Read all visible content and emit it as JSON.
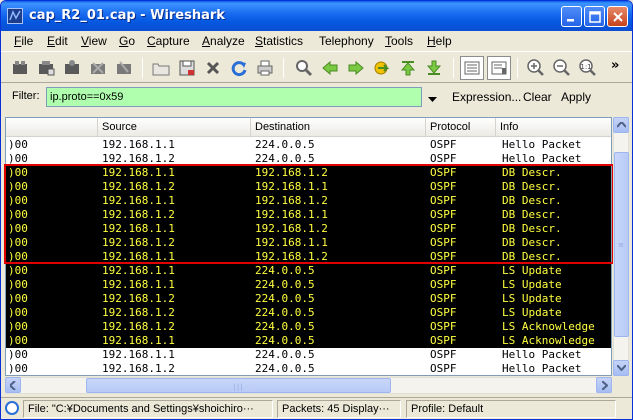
{
  "window": {
    "title": "cap_R2_01.cap - Wireshark"
  },
  "menu": [
    {
      "label": "File",
      "u": "F",
      "rest": "ile"
    },
    {
      "label": "Edit",
      "u": "E",
      "rest": "dit"
    },
    {
      "label": "View",
      "u": "V",
      "rest": "iew"
    },
    {
      "label": "Go",
      "u": "G",
      "rest": "o"
    },
    {
      "label": "Capture",
      "u": "C",
      "rest": "apture"
    },
    {
      "label": "Analyze",
      "u": "A",
      "rest": "nalyze"
    },
    {
      "label": "Statistics",
      "u": "S",
      "rest": "tatistics"
    },
    {
      "label": "Telephony",
      "u": "",
      "rest": "Telephony"
    },
    {
      "label": "Tools",
      "u": "T",
      "rest": "ools"
    },
    {
      "label": "Help",
      "u": "H",
      "rest": "elp"
    }
  ],
  "filter": {
    "label": "Filter:",
    "value": "ip.proto==0x59",
    "expression": "Expression...",
    "clear": "Clear",
    "apply": "Apply"
  },
  "columns": [
    "Source",
    "Destination",
    "Protocol",
    "Info"
  ],
  "packets": [
    {
      "no": ")00",
      "src": "192.168.1.1",
      "dst": "224.0.0.5",
      "proto": "OSPF",
      "info": "Hello Packet",
      "style": "hello"
    },
    {
      "no": ")00",
      "src": "192.168.1.2",
      "dst": "224.0.0.5",
      "proto": "OSPF",
      "info": "Hello Packet",
      "style": "hello"
    },
    {
      "no": ")00",
      "src": "192.168.1.1",
      "dst": "192.168.1.2",
      "proto": "OSPF",
      "info": "DB Descr.",
      "style": "db"
    },
    {
      "no": ")00",
      "src": "192.168.1.2",
      "dst": "192.168.1.1",
      "proto": "OSPF",
      "info": "DB Descr.",
      "style": "db"
    },
    {
      "no": ")00",
      "src": "192.168.1.1",
      "dst": "192.168.1.2",
      "proto": "OSPF",
      "info": "DB Descr.",
      "style": "db"
    },
    {
      "no": ")00",
      "src": "192.168.1.2",
      "dst": "192.168.1.1",
      "proto": "OSPF",
      "info": "DB Descr.",
      "style": "db"
    },
    {
      "no": ")00",
      "src": "192.168.1.1",
      "dst": "192.168.1.2",
      "proto": "OSPF",
      "info": "DB Descr.",
      "style": "db"
    },
    {
      "no": ")00",
      "src": "192.168.1.2",
      "dst": "192.168.1.1",
      "proto": "OSPF",
      "info": "DB Descr.",
      "style": "db"
    },
    {
      "no": ")00",
      "src": "192.168.1.1",
      "dst": "192.168.1.2",
      "proto": "OSPF",
      "info": "DB Descr.",
      "style": "db"
    },
    {
      "no": ")00",
      "src": "192.168.1.1",
      "dst": "224.0.0.5",
      "proto": "OSPF",
      "info": "LS Update",
      "style": "ls"
    },
    {
      "no": ")00",
      "src": "192.168.1.1",
      "dst": "224.0.0.5",
      "proto": "OSPF",
      "info": "LS Update",
      "style": "ls"
    },
    {
      "no": ")00",
      "src": "192.168.1.2",
      "dst": "224.0.0.5",
      "proto": "OSPF",
      "info": "LS Update",
      "style": "ls"
    },
    {
      "no": ")00",
      "src": "192.168.1.2",
      "dst": "224.0.0.5",
      "proto": "OSPF",
      "info": "LS Update",
      "style": "ls"
    },
    {
      "no": ")00",
      "src": "192.168.1.2",
      "dst": "224.0.0.5",
      "proto": "OSPF",
      "info": "LS Acknowledge",
      "style": "ls"
    },
    {
      "no": ")00",
      "src": "192.168.1.1",
      "dst": "224.0.0.5",
      "proto": "OSPF",
      "info": "LS Acknowledge",
      "style": "ls"
    },
    {
      "no": ")00",
      "src": "192.168.1.1",
      "dst": "224.0.0.5",
      "proto": "OSPF",
      "info": "Hello Packet",
      "style": "hello"
    },
    {
      "no": ")00",
      "src": "192.168.1.2",
      "dst": "224.0.0.5",
      "proto": "OSPF",
      "info": "Hello Packet",
      "style": "hello"
    }
  ],
  "status": {
    "file": "File: \"C:¥Documents and Settings¥shoichiro···",
    "packets": "Packets: 45 Display···",
    "profile": "Profile: Default"
  },
  "colors": {
    "filter_bg": "#afffaf",
    "row_dark_bg": "#000000",
    "row_dark_fg": "#ffff40",
    "highlight_border": "#e00000",
    "title_blue": "#0a5ee8"
  }
}
